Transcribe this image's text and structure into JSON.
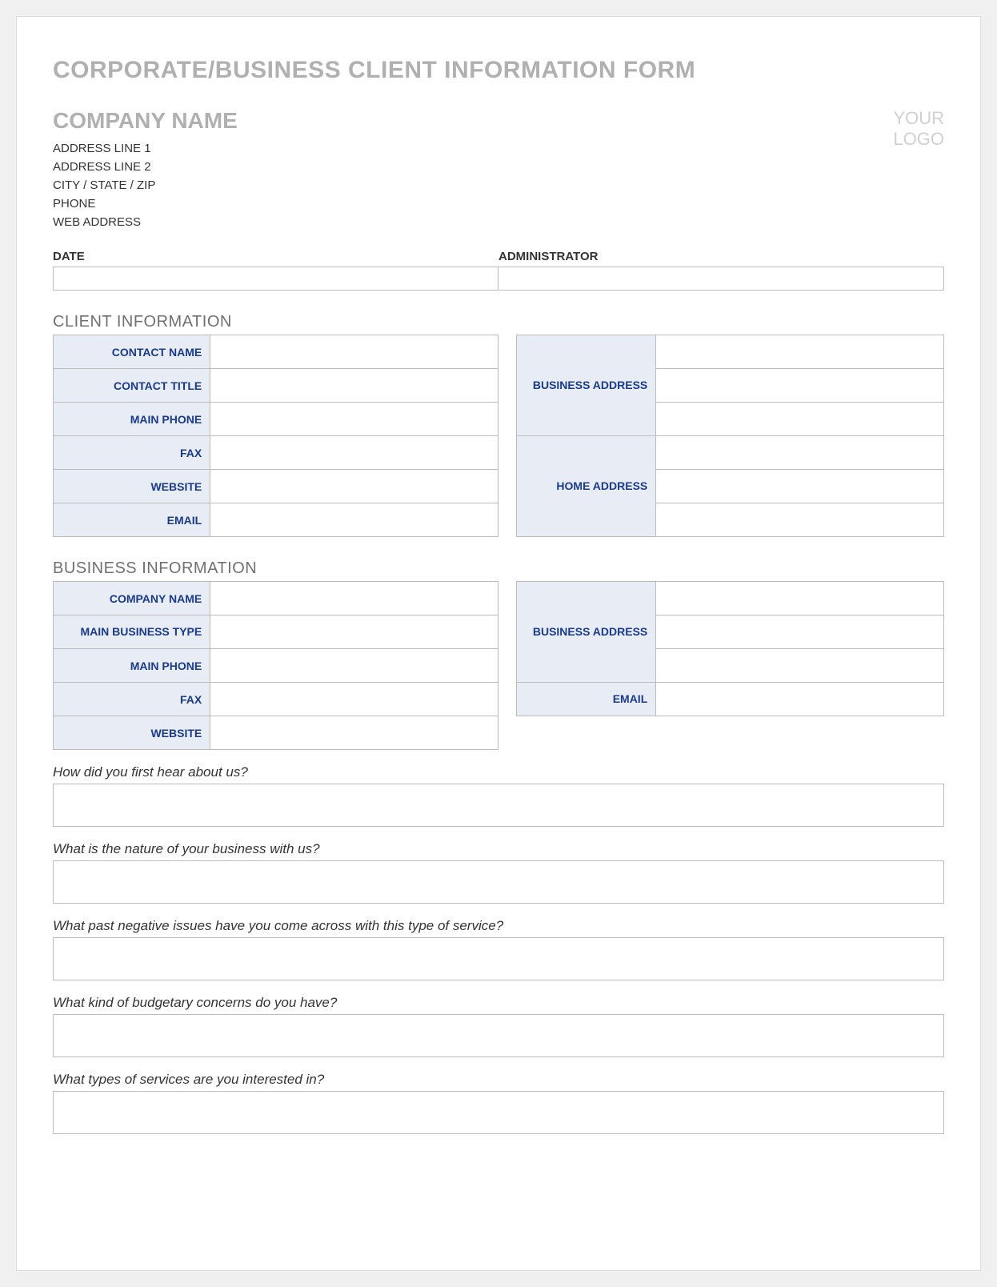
{
  "form_title": "CORPORATE/BUSINESS CLIENT INFORMATION FORM",
  "company": {
    "name": "COMPANY NAME",
    "address1": "ADDRESS LINE 1",
    "address2": "ADDRESS LINE 2",
    "city_state_zip": "CITY / STATE / ZIP",
    "phone": "PHONE",
    "web": "WEB ADDRESS"
  },
  "logo_placeholder": {
    "line1": "YOUR",
    "line2": "LOGO"
  },
  "date_admin": {
    "date_label": "DATE",
    "admin_label": "ADMINISTRATOR",
    "date_value": "",
    "admin_value": ""
  },
  "sections": {
    "client_heading": "CLIENT INFORMATION",
    "business_heading": "BUSINESS INFORMATION"
  },
  "client": {
    "contact_name_label": "CONTACT NAME",
    "contact_title_label": "CONTACT TITLE",
    "main_phone_label": "MAIN PHONE",
    "fax_label": "FAX",
    "website_label": "WEBSITE",
    "email_label": "EMAIL",
    "business_address_label": "BUSINESS ADDRESS",
    "home_address_label": "HOME ADDRESS"
  },
  "business": {
    "company_name_label": "COMPANY NAME",
    "main_business_type_label": "MAIN BUSINESS TYPE",
    "main_phone_label": "MAIN PHONE",
    "fax_label": "FAX",
    "website_label": "WEBSITE",
    "business_address_label": "BUSINESS ADDRESS",
    "email_label": "EMAIL"
  },
  "questions": {
    "q1": "How did you first hear about us?",
    "q2": "What is the nature of your business with us?",
    "q3": "What past negative issues have you come across with this type of service?",
    "q4": "What kind of budgetary concerns do you have?",
    "q5": "What types of services are you interested in?"
  }
}
